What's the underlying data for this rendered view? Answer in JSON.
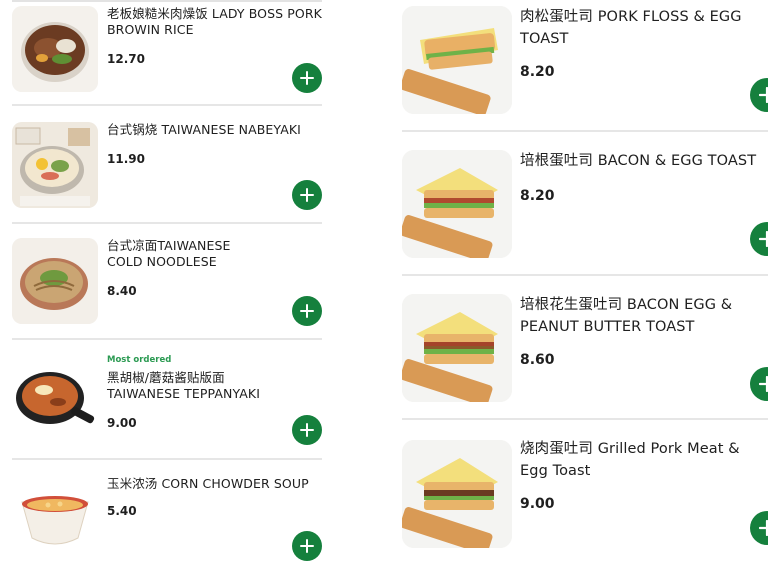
{
  "left_menu": [
    {
      "name": "老板娘糙米肉燥饭 LADY BOSS PORK BROWIN RICE",
      "price": "12.70",
      "tag": ""
    },
    {
      "name": "台式锅烧 TAIWANESE NABEYAKI",
      "price": "11.90",
      "tag": ""
    },
    {
      "name": "台式凉面TAIWANESE COLD NOODLESE",
      "price": "8.40",
      "tag": ""
    },
    {
      "name": "黑胡椒/蘑菇酱贴版面 TAIWANESE TEPPANYAKI",
      "price": "9.00",
      "tag": "Most ordered"
    },
    {
      "name": "玉米浓汤 CORN CHOWDER SOUP",
      "price": "5.40",
      "tag": ""
    }
  ],
  "right_menu": [
    {
      "name": "肉松蛋吐司 PORK FLOSS & EGG TOAST",
      "price": "8.20"
    },
    {
      "name": "培根蛋吐司 BACON & EGG TOAST",
      "price": "8.20"
    },
    {
      "name": "培根花生蛋吐司 BACON EGG & PEANUT BUTTER TOAST",
      "price": "8.60"
    },
    {
      "name": "烧肉蛋吐司 Grilled Pork Meat & Egg Toast",
      "price": "9.00"
    }
  ],
  "icons": {
    "add": "plus-icon"
  },
  "colors": {
    "accent": "#15803d",
    "tag": "#2b9a52"
  }
}
